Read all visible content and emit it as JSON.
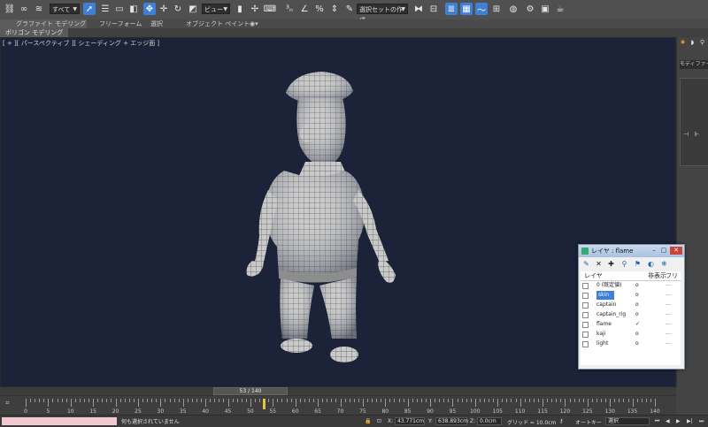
{
  "toolbar": {
    "selection_filter": "すべて",
    "reference_coord": "ビュー",
    "named_selection": "選択セットの作成"
  },
  "ribbon": {
    "tabs": [
      "グラファイト モデリング ツール",
      "フリーフォーム",
      "選択",
      "オブジェクト ペイント"
    ],
    "subtab": "ポリゴン モデリング"
  },
  "viewport": {
    "label": "[ + ][ パースペクティブ ][ シェーディング + エッジ面 ]",
    "background": "#1c2338"
  },
  "command_panel": {
    "modifier_label": "モディファイヤ"
  },
  "layer_window": {
    "title": "レイヤ : flame",
    "headers": {
      "layer": "レイヤ",
      "hide": "非表示",
      "freeze": "フリーズ"
    },
    "layers": [
      {
        "name": "0 (既定値)",
        "hide": "o",
        "freeze": "---",
        "selected": false
      },
      {
        "name": "skin",
        "hide": "o",
        "freeze": "---",
        "selected": true
      },
      {
        "name": "captain",
        "hide": "o",
        "freeze": "---",
        "selected": false
      },
      {
        "name": "captain_rig",
        "hide": "o",
        "freeze": "---",
        "selected": false
      },
      {
        "name": "flame",
        "hide": "✓",
        "freeze": "---",
        "selected": false
      },
      {
        "name": "kaji",
        "hide": "o",
        "freeze": "---",
        "selected": false
      },
      {
        "name": "light",
        "hide": "o",
        "freeze": "---",
        "selected": false
      }
    ]
  },
  "timeline": {
    "frame_display": "53 / 140",
    "current_frame": 53,
    "total_frames": 140,
    "ticks": [
      0,
      5,
      10,
      15,
      20,
      25,
      30,
      35,
      40,
      45,
      50,
      55,
      60,
      65,
      70,
      75,
      80,
      85,
      90,
      95,
      100,
      105,
      110,
      115,
      120,
      125,
      130,
      135,
      140
    ]
  },
  "status": {
    "message": "何も選択されていません",
    "x_label": "X:",
    "x_value": "43.771cm",
    "y_label": "Y:",
    "y_value": "638.893cm",
    "z_label": "Z:",
    "z_value": "0.0cm",
    "grid": "グリッド = 10.0cm",
    "autokey": "オートキー",
    "key_mode": "選択"
  }
}
